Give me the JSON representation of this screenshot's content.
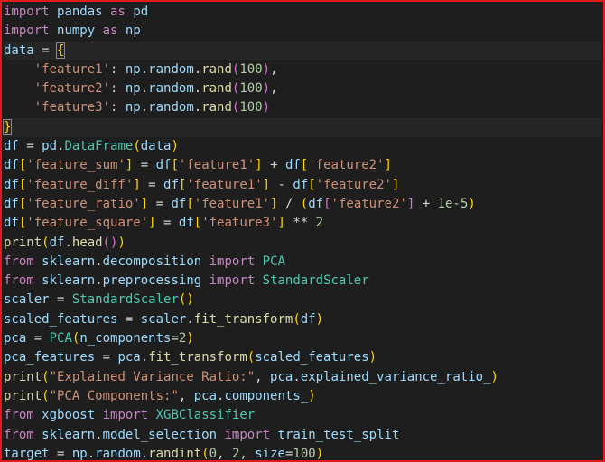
{
  "editor": {
    "lines": [
      [
        [
          "kw",
          "import"
        ],
        [
          "op",
          " "
        ],
        [
          "id",
          "pandas"
        ],
        [
          "op",
          " "
        ],
        [
          "kw",
          "as"
        ],
        [
          "op",
          " "
        ],
        [
          "id",
          "pd"
        ]
      ],
      [
        [
          "kw",
          "import"
        ],
        [
          "op",
          " "
        ],
        [
          "id",
          "numpy"
        ],
        [
          "op",
          " "
        ],
        [
          "kw",
          "as"
        ],
        [
          "op",
          " "
        ],
        [
          "id",
          "np"
        ]
      ],
      [
        [
          "id",
          "data"
        ],
        [
          "op",
          " = "
        ],
        [
          "brx",
          "{"
        ]
      ],
      [
        [
          "op",
          "    "
        ],
        [
          "str",
          "'feature1'"
        ],
        [
          "op",
          ": "
        ],
        [
          "id",
          "np"
        ],
        [
          "op",
          "."
        ],
        [
          "id",
          "random"
        ],
        [
          "op",
          "."
        ],
        [
          "fn",
          "rand"
        ],
        [
          "br2",
          "("
        ],
        [
          "num",
          "100"
        ],
        [
          "br2",
          ")"
        ],
        [
          "op",
          ","
        ]
      ],
      [
        [
          "op",
          "    "
        ],
        [
          "str",
          "'feature2'"
        ],
        [
          "op",
          ": "
        ],
        [
          "id",
          "np"
        ],
        [
          "op",
          "."
        ],
        [
          "id",
          "random"
        ],
        [
          "op",
          "."
        ],
        [
          "fn",
          "rand"
        ],
        [
          "br2",
          "("
        ],
        [
          "num",
          "100"
        ],
        [
          "br2",
          ")"
        ],
        [
          "op",
          ","
        ]
      ],
      [
        [
          "op",
          "    "
        ],
        [
          "str",
          "'feature3'"
        ],
        [
          "op",
          ": "
        ],
        [
          "id",
          "np"
        ],
        [
          "op",
          "."
        ],
        [
          "id",
          "random"
        ],
        [
          "op",
          "."
        ],
        [
          "fn",
          "rand"
        ],
        [
          "br2",
          "("
        ],
        [
          "num",
          "100"
        ],
        [
          "br2",
          ")"
        ]
      ],
      [
        [
          "brx",
          "}"
        ]
      ],
      [
        [
          "id",
          "df"
        ],
        [
          "op",
          " = "
        ],
        [
          "id",
          "pd"
        ],
        [
          "op",
          "."
        ],
        [
          "cls",
          "DataFrame"
        ],
        [
          "br1",
          "("
        ],
        [
          "id",
          "data"
        ],
        [
          "br1",
          ")"
        ]
      ],
      [
        [
          "id",
          "df"
        ],
        [
          "br1",
          "["
        ],
        [
          "str",
          "'feature_sum'"
        ],
        [
          "br1",
          "]"
        ],
        [
          "op",
          " = "
        ],
        [
          "id",
          "df"
        ],
        [
          "br1",
          "["
        ],
        [
          "str",
          "'feature1'"
        ],
        [
          "br1",
          "]"
        ],
        [
          "op",
          " + "
        ],
        [
          "id",
          "df"
        ],
        [
          "br1",
          "["
        ],
        [
          "str",
          "'feature2'"
        ],
        [
          "br1",
          "]"
        ]
      ],
      [
        [
          "id",
          "df"
        ],
        [
          "br1",
          "["
        ],
        [
          "str",
          "'feature_diff'"
        ],
        [
          "br1",
          "]"
        ],
        [
          "op",
          " = "
        ],
        [
          "id",
          "df"
        ],
        [
          "br1",
          "["
        ],
        [
          "str",
          "'feature1'"
        ],
        [
          "br1",
          "]"
        ],
        [
          "op",
          " - "
        ],
        [
          "id",
          "df"
        ],
        [
          "br1",
          "["
        ],
        [
          "str",
          "'feature2'"
        ],
        [
          "br1",
          "]"
        ]
      ],
      [
        [
          "id",
          "df"
        ],
        [
          "br1",
          "["
        ],
        [
          "str",
          "'feature_ratio'"
        ],
        [
          "br1",
          "]"
        ],
        [
          "op",
          " = "
        ],
        [
          "id",
          "df"
        ],
        [
          "br1",
          "["
        ],
        [
          "str",
          "'feature1'"
        ],
        [
          "br1",
          "]"
        ],
        [
          "op",
          " / "
        ],
        [
          "br1",
          "("
        ],
        [
          "id",
          "df"
        ],
        [
          "br2",
          "["
        ],
        [
          "str",
          "'feature2'"
        ],
        [
          "br2",
          "]"
        ],
        [
          "op",
          " + "
        ],
        [
          "num",
          "1e-5"
        ],
        [
          "br1",
          ")"
        ]
      ],
      [
        [
          "id",
          "df"
        ],
        [
          "br1",
          "["
        ],
        [
          "str",
          "'feature_square'"
        ],
        [
          "br1",
          "]"
        ],
        [
          "op",
          " = "
        ],
        [
          "id",
          "df"
        ],
        [
          "br1",
          "["
        ],
        [
          "str",
          "'feature3'"
        ],
        [
          "br1",
          "]"
        ],
        [
          "op",
          " ** "
        ],
        [
          "num",
          "2"
        ]
      ],
      [
        [
          "fn",
          "print"
        ],
        [
          "br1",
          "("
        ],
        [
          "id",
          "df"
        ],
        [
          "op",
          "."
        ],
        [
          "fn",
          "head"
        ],
        [
          "br2",
          "()"
        ],
        [
          "br1",
          ")"
        ]
      ],
      [
        [
          "kw",
          "from"
        ],
        [
          "op",
          " "
        ],
        [
          "id",
          "sklearn"
        ],
        [
          "op",
          "."
        ],
        [
          "id",
          "decomposition"
        ],
        [
          "op",
          " "
        ],
        [
          "kw",
          "import"
        ],
        [
          "op",
          " "
        ],
        [
          "cls",
          "PCA"
        ]
      ],
      [
        [
          "kw",
          "from"
        ],
        [
          "op",
          " "
        ],
        [
          "id",
          "sklearn"
        ],
        [
          "op",
          "."
        ],
        [
          "id",
          "preprocessing"
        ],
        [
          "op",
          " "
        ],
        [
          "kw",
          "import"
        ],
        [
          "op",
          " "
        ],
        [
          "cls",
          "StandardScaler"
        ]
      ],
      [
        [
          "id",
          "scaler"
        ],
        [
          "op",
          " = "
        ],
        [
          "cls",
          "StandardScaler"
        ],
        [
          "br1",
          "()"
        ]
      ],
      [
        [
          "id",
          "scaled_features"
        ],
        [
          "op",
          " = "
        ],
        [
          "id",
          "scaler"
        ],
        [
          "op",
          "."
        ],
        [
          "fn",
          "fit_transform"
        ],
        [
          "br1",
          "("
        ],
        [
          "id",
          "df"
        ],
        [
          "br1",
          ")"
        ]
      ],
      [
        [
          "id",
          "pca"
        ],
        [
          "op",
          " = "
        ],
        [
          "cls",
          "PCA"
        ],
        [
          "br1",
          "("
        ],
        [
          "id",
          "n_components"
        ],
        [
          "op",
          "="
        ],
        [
          "num",
          "2"
        ],
        [
          "br1",
          ")"
        ]
      ],
      [
        [
          "id",
          "pca_features"
        ],
        [
          "op",
          " = "
        ],
        [
          "id",
          "pca"
        ],
        [
          "op",
          "."
        ],
        [
          "fn",
          "fit_transform"
        ],
        [
          "br1",
          "("
        ],
        [
          "id",
          "scaled_features"
        ],
        [
          "br1",
          ")"
        ]
      ],
      [
        [
          "fn",
          "print"
        ],
        [
          "br1",
          "("
        ],
        [
          "str",
          "\"Explained Variance Ratio:\""
        ],
        [
          "op",
          ", "
        ],
        [
          "id",
          "pca"
        ],
        [
          "op",
          "."
        ],
        [
          "id",
          "explained_variance_ratio_"
        ],
        [
          "br1",
          ")"
        ]
      ],
      [
        [
          "fn",
          "print"
        ],
        [
          "br1",
          "("
        ],
        [
          "str",
          "\"PCA Components:\""
        ],
        [
          "op",
          ", "
        ],
        [
          "id",
          "pca"
        ],
        [
          "op",
          "."
        ],
        [
          "id",
          "components_"
        ],
        [
          "br1",
          ")"
        ]
      ],
      [
        [
          "kw",
          "from"
        ],
        [
          "op",
          " "
        ],
        [
          "id",
          "xgboost"
        ],
        [
          "op",
          " "
        ],
        [
          "kw",
          "import"
        ],
        [
          "op",
          " "
        ],
        [
          "cls",
          "XGBClassifier"
        ]
      ],
      [
        [
          "kw",
          "from"
        ],
        [
          "op",
          " "
        ],
        [
          "id",
          "sklearn"
        ],
        [
          "op",
          "."
        ],
        [
          "id",
          "model_selection"
        ],
        [
          "op",
          " "
        ],
        [
          "kw",
          "import"
        ],
        [
          "op",
          " "
        ],
        [
          "id",
          "train_test_split"
        ]
      ],
      [
        [
          "id",
          "target"
        ],
        [
          "op",
          " = "
        ],
        [
          "id",
          "np"
        ],
        [
          "op",
          "."
        ],
        [
          "id",
          "random"
        ],
        [
          "op",
          "."
        ],
        [
          "fn",
          "randint"
        ],
        [
          "br1",
          "("
        ],
        [
          "num",
          "0"
        ],
        [
          "op",
          ", "
        ],
        [
          "num",
          "2"
        ],
        [
          "op",
          ", "
        ],
        [
          "id",
          "size"
        ],
        [
          "op",
          "="
        ],
        [
          "num",
          "100"
        ],
        [
          "br1",
          ")"
        ]
      ]
    ],
    "guide_lines": [
      3,
      4,
      5
    ],
    "highlight_lines": [
      2,
      6
    ]
  }
}
